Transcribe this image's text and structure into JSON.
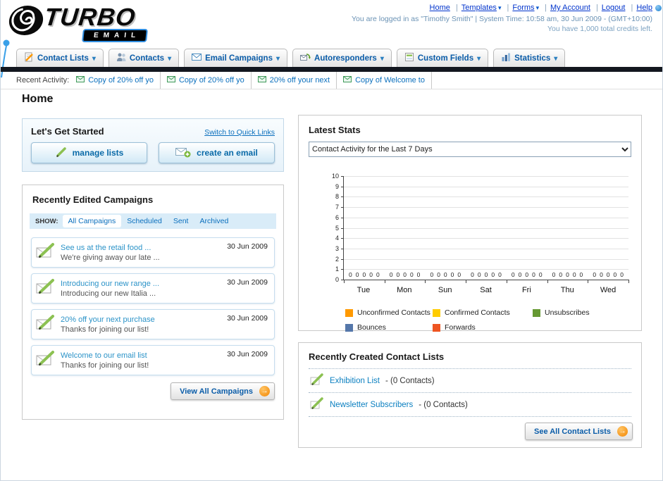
{
  "header": {
    "logo": {
      "line1": "TURBO",
      "line2": "EMAIL"
    },
    "links": [
      "Home",
      "Templates",
      "Forms",
      "My Account",
      "Logout",
      "Help"
    ],
    "login_info": "You are logged in as \"Timothy Smith\" | System Time: 10:58 am, 30 Jun 2009 - (GMT+10:00)",
    "credits_info": "You have 1,000 total credits left."
  },
  "nav": {
    "tabs": [
      "Contact Lists",
      "Contacts",
      "Email Campaigns",
      "Autoresponders",
      "Custom Fields",
      "Statistics"
    ]
  },
  "recent_activity": {
    "label": "Recent Activity:",
    "items": [
      "Copy of 20% off yo",
      "Copy of 20% off yo",
      "20% off your next",
      "Copy of Welcome to"
    ]
  },
  "page_title": "Home",
  "get_started": {
    "title": "Let's Get Started",
    "switch_link": "Switch to Quick Links",
    "manage_lists_label": "manage lists",
    "create_email_label": "create an email"
  },
  "campaigns": {
    "title": "Recently Edited Campaigns",
    "show_label": "SHOW:",
    "filters": [
      "All Campaigns",
      "Scheduled",
      "Sent",
      "Archived"
    ],
    "active_filter": "All Campaigns",
    "items": [
      {
        "title": "See us at the retail food ...",
        "subtitle": "We're giving away our late ...",
        "date": "30 Jun 2009"
      },
      {
        "title": "Introducing our new range ...",
        "subtitle": "Introducing our new Italia ...",
        "date": "30 Jun 2009"
      },
      {
        "title": "20% off your next purchase",
        "subtitle": "Thanks for joining our list!",
        "date": "30 Jun 2009"
      },
      {
        "title": "Welcome to our email list",
        "subtitle": "Thanks for joining our list!",
        "date": "30 Jun 2009"
      }
    ],
    "view_all_label": "View All Campaigns"
  },
  "stats": {
    "title": "Latest Stats",
    "range_selected": "Contact Activity for the Last 7 Days",
    "chart_data": {
      "type": "bar",
      "categories": [
        "Tue",
        "Mon",
        "Sun",
        "Sat",
        "Fri",
        "Thu",
        "Wed"
      ],
      "series": [
        {
          "name": "Unconfirmed Contacts",
          "color": "#FF9900",
          "values": [
            0,
            0,
            0,
            0,
            0,
            0,
            0
          ]
        },
        {
          "name": "Confirmed Contacts",
          "color": "#FFCC00",
          "values": [
            0,
            0,
            0,
            0,
            0,
            0,
            0
          ]
        },
        {
          "name": "Unsubscribes",
          "color": "#669933",
          "values": [
            0,
            0,
            0,
            0,
            0,
            0,
            0
          ]
        },
        {
          "name": "Bounces",
          "color": "#5577AA",
          "values": [
            0,
            0,
            0,
            0,
            0,
            0,
            0
          ]
        },
        {
          "name": "Forwards",
          "color": "#EE5522",
          "values": [
            0,
            0,
            0,
            0,
            0,
            0,
            0
          ]
        }
      ],
      "ylim": [
        0,
        10
      ],
      "yticks": [
        0,
        1,
        2,
        3,
        4,
        5,
        6,
        7,
        8,
        9,
        10
      ],
      "grid": true,
      "legend_position": "bottom"
    }
  },
  "contact_lists": {
    "title": "Recently Created Contact Lists",
    "items": [
      {
        "name": "Exhibition List",
        "detail": "- (0 Contacts)"
      },
      {
        "name": "Newsletter Subscribers",
        "detail": "- (0 Contacts)"
      }
    ],
    "see_all_label": "See All Contact Lists"
  }
}
